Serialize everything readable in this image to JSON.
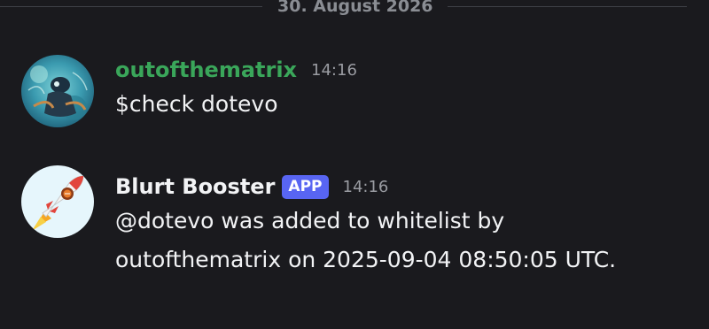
{
  "divider": {
    "date": "30. August 2026"
  },
  "messages": [
    {
      "author": "outofthematrix",
      "time": "14:16",
      "lines": [
        "$check dotevo"
      ],
      "avatar_icon": "diver-underwater-avatar"
    },
    {
      "author": "Blurt Booster",
      "badge": "APP",
      "time": "14:16",
      "lines": [
        "@dotevo was added to whitelist by",
        "outofthematrix on 2025-09-04 08:50:05 UTC."
      ],
      "avatar_icon": "rocket-avatar"
    }
  ],
  "colors": {
    "background": "#1a1a1e",
    "user_name_green": "#3aa65a",
    "app_badge": "#5865f2"
  }
}
